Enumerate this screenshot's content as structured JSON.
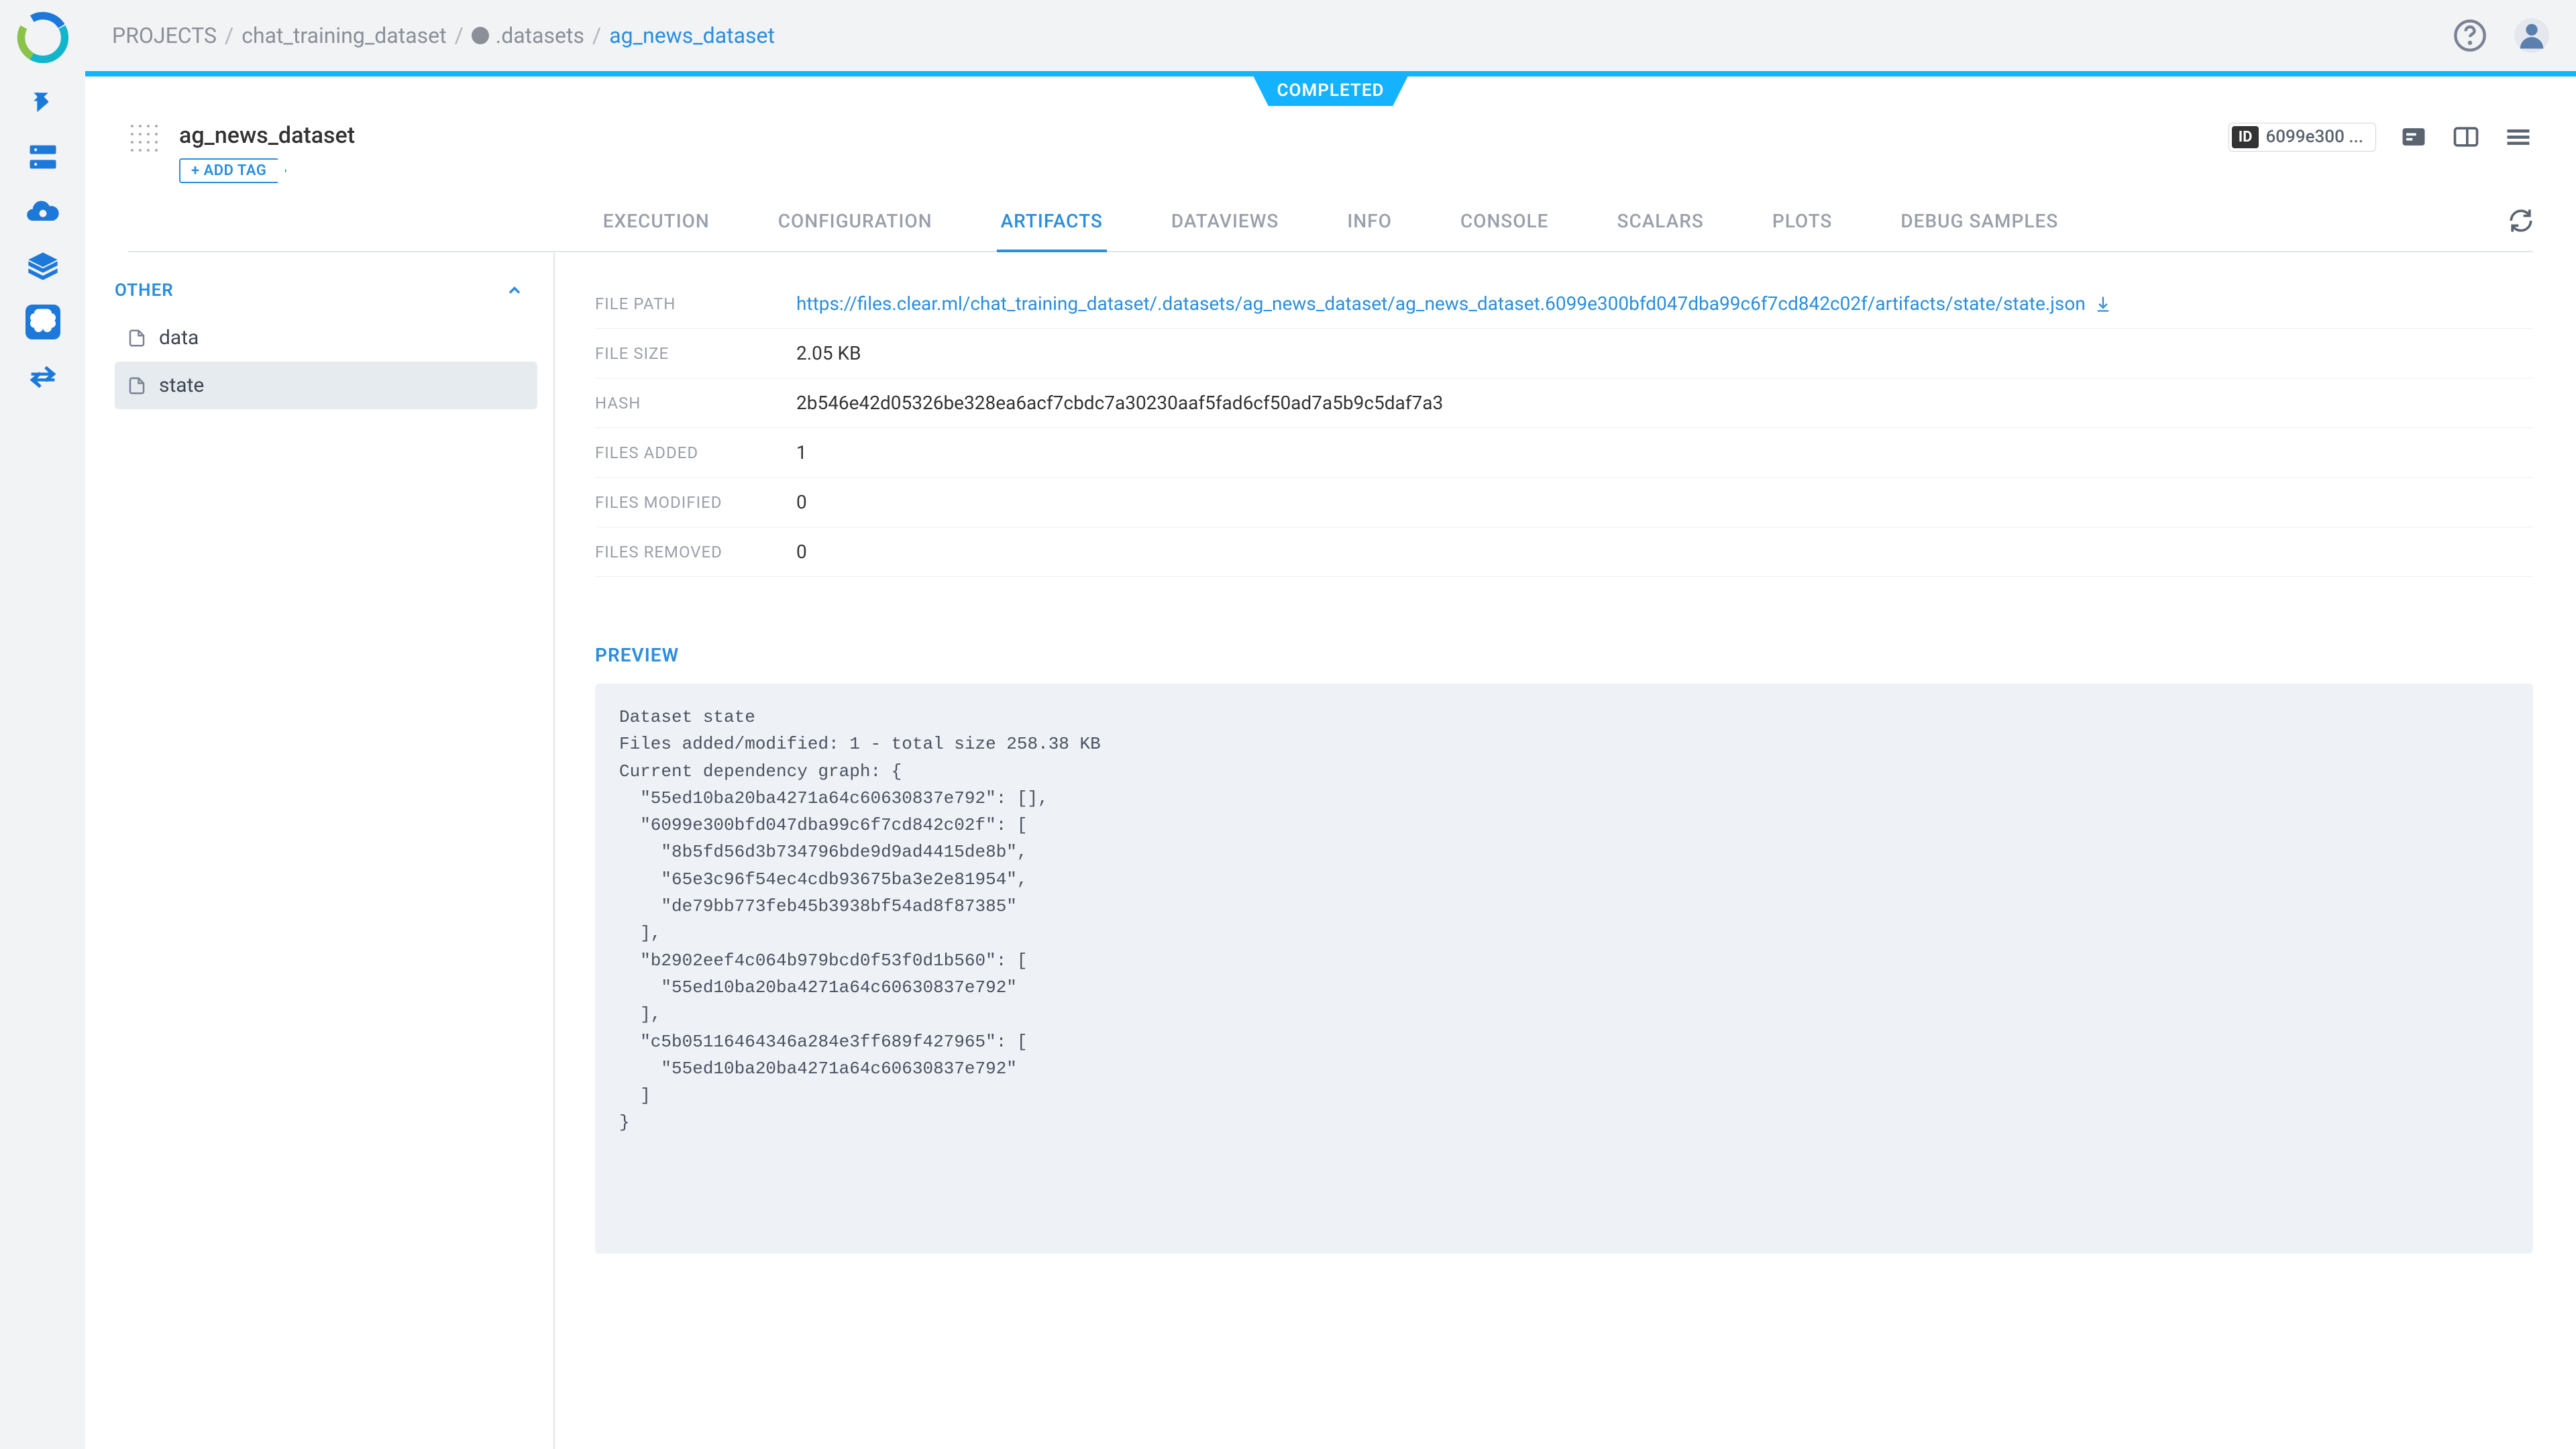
{
  "breadcrumbs": {
    "root": "PROJECTS",
    "project": "chat_training_dataset",
    "datasets": ".datasets",
    "current": "ag_news_dataset"
  },
  "status": "COMPLETED",
  "title": "ag_news_dataset",
  "add_tag_label": "ADD TAG",
  "id_label": "ID",
  "id_value": "6099e300 ...",
  "tabs": {
    "execution": "EXECUTION",
    "configuration": "CONFIGURATION",
    "artifacts": "ARTIFACTS",
    "dataviews": "DATAVIEWS",
    "info": "INFO",
    "console": "CONSOLE",
    "scalars": "SCALARS",
    "plots": "PLOTS",
    "debug_samples": "DEBUG SAMPLES"
  },
  "side": {
    "heading": "OTHER",
    "items": {
      "data": "data",
      "state": "state"
    }
  },
  "details": {
    "file_path_label": "FILE PATH",
    "file_path_value": "https://files.clear.ml/chat_training_dataset/.datasets/ag_news_dataset/ag_news_dataset.6099e300bfd047dba99c6f7cd842c02f/artifacts/state/state.json",
    "file_size_label": "FILE SIZE",
    "file_size_value": "2.05 KB",
    "hash_label": "HASH",
    "hash_value": "2b546e42d05326be328ea6acf7cbdc7a30230aaf5fad6cf50ad7a5b9c5daf7a3",
    "files_added_label": "FILES ADDED",
    "files_added_value": "1",
    "files_modified_label": "FILES MODIFIED",
    "files_modified_value": "0",
    "files_removed_label": "FILES REMOVED",
    "files_removed_value": "0"
  },
  "preview_heading": "PREVIEW",
  "preview_text": "Dataset state\nFiles added/modified: 1 - total size 258.38 KB\nCurrent dependency graph: {\n  \"55ed10ba20ba4271a64c60630837e792\": [],\n  \"6099e300bfd047dba99c6f7cd842c02f\": [\n    \"8b5fd56d3b734796bde9d9ad4415de8b\",\n    \"65e3c96f54ec4cdb93675ba3e2e81954\",\n    \"de79bb773feb45b3938bf54ad8f87385\"\n  ],\n  \"b2902eef4c064b979bcd0f53f0d1b560\": [\n    \"55ed10ba20ba4271a64c60630837e792\"\n  ],\n  \"c5b05116464346a284e3ff689f427965\": [\n    \"55ed10ba20ba4271a64c60630837e792\"\n  ]\n}"
}
